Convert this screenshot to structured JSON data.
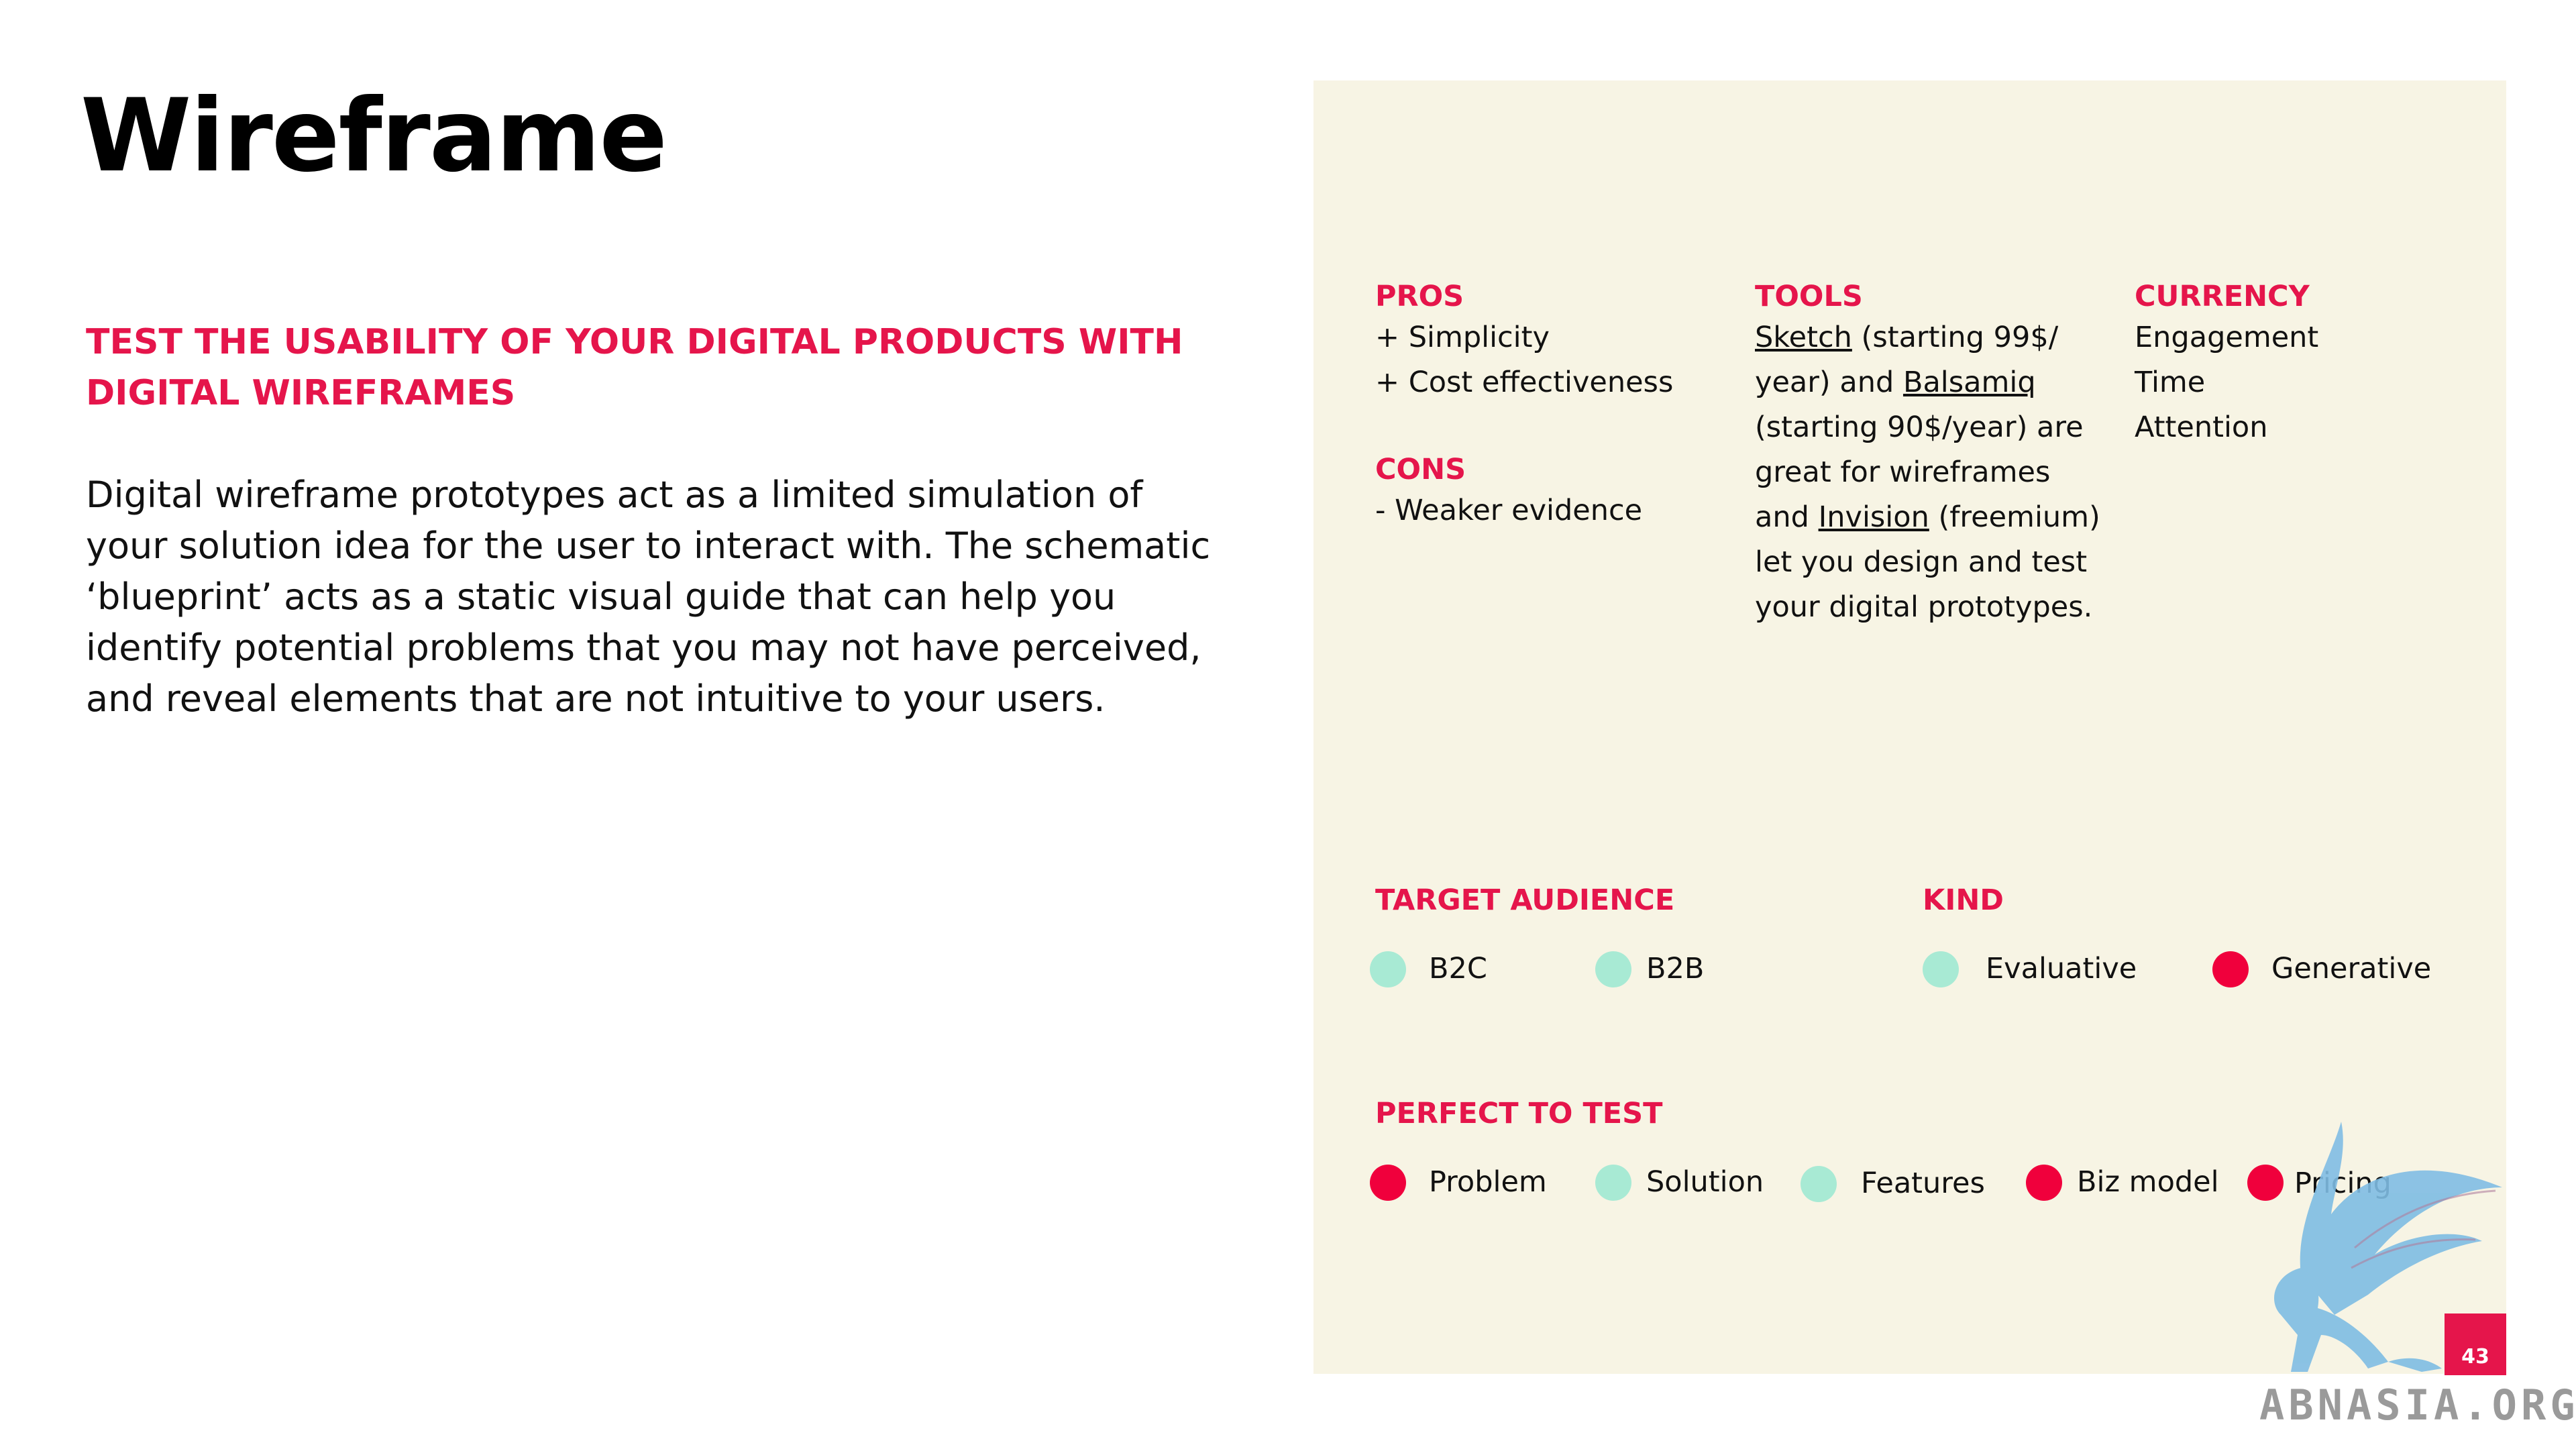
{
  "title": "Wireframe",
  "subtitle": "TEST THE USABILITY OF YOUR DIGITAL PRODUCTS WITH DIGITAL WIREFRAMES",
  "body": "Digital wireframe prototypes act as a limited simulation of your solution idea for the user to interact with. The schematic ‘blueprint’ acts as a static visual guide that can help you identify potential problems that you may not have perceived, and reveal elements that are not intuitive to your users.",
  "pros": {
    "label": "PROS",
    "items": [
      "+ Simplicity",
      "+ Cost effectiveness"
    ]
  },
  "cons": {
    "label": "CONS",
    "items": [
      "-  Weaker evidence"
    ]
  },
  "tools": {
    "label": "TOOLS",
    "lines": [
      {
        "pre": "",
        "link": "Sketch",
        "post": " (starting 99$/"
      },
      {
        "pre": "year) and ",
        "link": "Balsamiq",
        "post": ""
      },
      {
        "pre": "(starting 90$/year) are",
        "link": "",
        "post": ""
      },
      {
        "pre": "great for wireframes",
        "link": "",
        "post": ""
      },
      {
        "pre": "and ",
        "link": "Invision",
        "post": " (freemium)"
      },
      {
        "pre": "let you design and test",
        "link": "",
        "post": ""
      },
      {
        "pre": "your digital prototypes.",
        "link": "",
        "post": ""
      }
    ]
  },
  "currency": {
    "label": "CURRENCY",
    "items": [
      "Engagement",
      "Time",
      "Attention"
    ]
  },
  "target_audience": {
    "label": "TARGET AUDIENCE",
    "options": [
      {
        "text": "B2C",
        "color": "#a8ead4"
      },
      {
        "text": "B2B",
        "color": "#a8ead4"
      }
    ]
  },
  "kind": {
    "label": "KIND",
    "options": [
      {
        "text": "Evaluative",
        "color": "#a8ead4"
      },
      {
        "text": "Generative",
        "color": "#f0003c"
      }
    ]
  },
  "perfect_to_test": {
    "label": "PERFECT TO TEST",
    "options": [
      {
        "text": "Problem",
        "color": "#f0003c"
      },
      {
        "text": "Solution",
        "color": "#a8ead4"
      },
      {
        "text": "Features",
        "color": "#a8ead4"
      },
      {
        "text": "Biz model",
        "color": "#f0003c"
      },
      {
        "text": "Pricing",
        "color": "#f0003c"
      }
    ]
  },
  "page_number": "43",
  "watermark": "ABNASIA.ORG",
  "colors": {
    "accent": "#e5154b",
    "panel": "#f7f4e4",
    "mint": "#a8ead4",
    "red": "#f0003c"
  }
}
